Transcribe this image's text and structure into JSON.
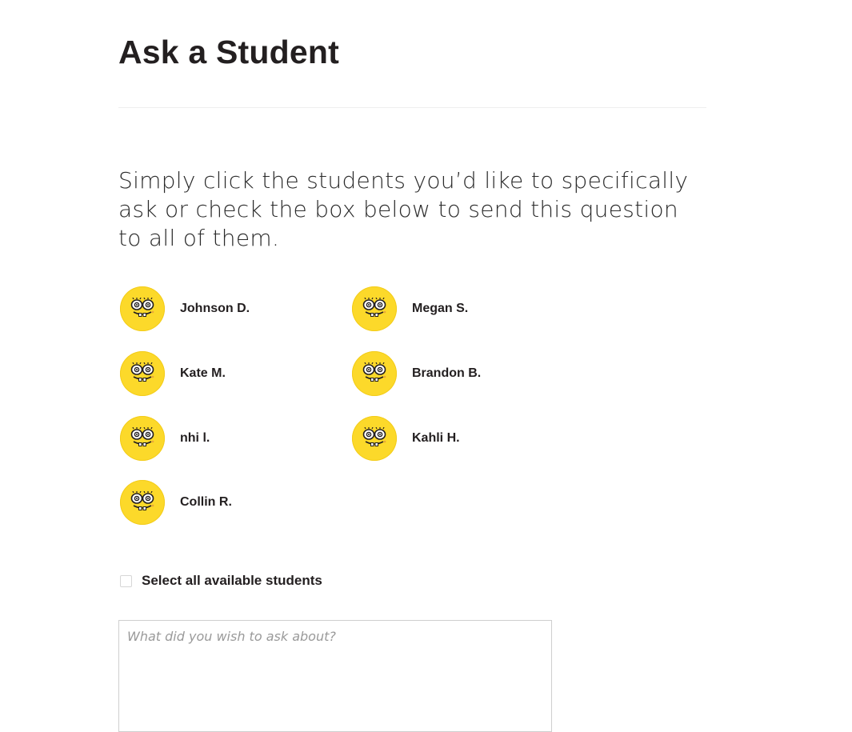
{
  "page": {
    "title": "Ask a Student",
    "intro": "Simply click the students you’d like to specifically ask or check the box below to send this question to all of them."
  },
  "students": [
    {
      "name": "Johnson D.",
      "avatar_icon": "spongebob-avatar-icon"
    },
    {
      "name": "Megan S.",
      "avatar_icon": "spongebob-avatar-icon"
    },
    {
      "name": "Kate M.",
      "avatar_icon": "spongebob-avatar-icon"
    },
    {
      "name": "Brandon B.",
      "avatar_icon": "spongebob-avatar-icon"
    },
    {
      "name": "nhi l.",
      "avatar_icon": "spongebob-avatar-icon"
    },
    {
      "name": "Kahli H.",
      "avatar_icon": "spongebob-avatar-icon"
    },
    {
      "name": "Collin R.",
      "avatar_icon": "spongebob-avatar-icon"
    }
  ],
  "select_all": {
    "label": "Select all available students",
    "checked": false
  },
  "question": {
    "placeholder": "What did you wish to ask about?",
    "value": ""
  },
  "colors": {
    "avatar_background": "#fcd92a",
    "text": "#231f20"
  }
}
